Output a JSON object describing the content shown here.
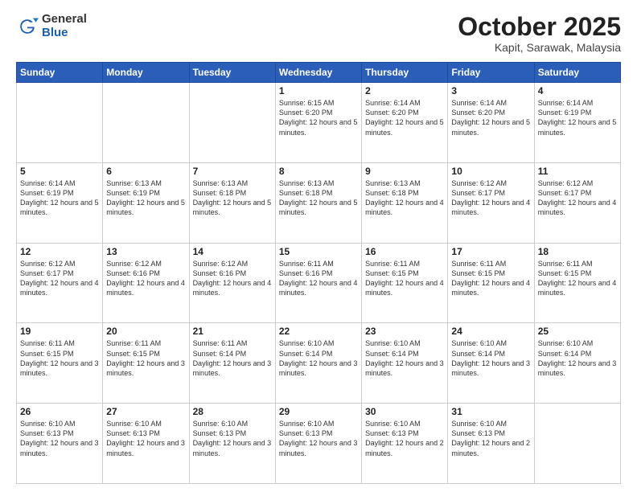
{
  "header": {
    "logo_general": "General",
    "logo_blue": "Blue",
    "month_title": "October 2025",
    "subtitle": "Kapit, Sarawak, Malaysia"
  },
  "days_of_week": [
    "Sunday",
    "Monday",
    "Tuesday",
    "Wednesday",
    "Thursday",
    "Friday",
    "Saturday"
  ],
  "weeks": [
    [
      {
        "day": "",
        "text": ""
      },
      {
        "day": "",
        "text": ""
      },
      {
        "day": "",
        "text": ""
      },
      {
        "day": "1",
        "text": "Sunrise: 6:15 AM\nSunset: 6:20 PM\nDaylight: 12 hours and 5 minutes."
      },
      {
        "day": "2",
        "text": "Sunrise: 6:14 AM\nSunset: 6:20 PM\nDaylight: 12 hours and 5 minutes."
      },
      {
        "day": "3",
        "text": "Sunrise: 6:14 AM\nSunset: 6:20 PM\nDaylight: 12 hours and 5 minutes."
      },
      {
        "day": "4",
        "text": "Sunrise: 6:14 AM\nSunset: 6:19 PM\nDaylight: 12 hours and 5 minutes."
      }
    ],
    [
      {
        "day": "5",
        "text": "Sunrise: 6:14 AM\nSunset: 6:19 PM\nDaylight: 12 hours and 5 minutes."
      },
      {
        "day": "6",
        "text": "Sunrise: 6:13 AM\nSunset: 6:19 PM\nDaylight: 12 hours and 5 minutes."
      },
      {
        "day": "7",
        "text": "Sunrise: 6:13 AM\nSunset: 6:18 PM\nDaylight: 12 hours and 5 minutes."
      },
      {
        "day": "8",
        "text": "Sunrise: 6:13 AM\nSunset: 6:18 PM\nDaylight: 12 hours and 5 minutes."
      },
      {
        "day": "9",
        "text": "Sunrise: 6:13 AM\nSunset: 6:18 PM\nDaylight: 12 hours and 4 minutes."
      },
      {
        "day": "10",
        "text": "Sunrise: 6:12 AM\nSunset: 6:17 PM\nDaylight: 12 hours and 4 minutes."
      },
      {
        "day": "11",
        "text": "Sunrise: 6:12 AM\nSunset: 6:17 PM\nDaylight: 12 hours and 4 minutes."
      }
    ],
    [
      {
        "day": "12",
        "text": "Sunrise: 6:12 AM\nSunset: 6:17 PM\nDaylight: 12 hours and 4 minutes."
      },
      {
        "day": "13",
        "text": "Sunrise: 6:12 AM\nSunset: 6:16 PM\nDaylight: 12 hours and 4 minutes."
      },
      {
        "day": "14",
        "text": "Sunrise: 6:12 AM\nSunset: 6:16 PM\nDaylight: 12 hours and 4 minutes."
      },
      {
        "day": "15",
        "text": "Sunrise: 6:11 AM\nSunset: 6:16 PM\nDaylight: 12 hours and 4 minutes."
      },
      {
        "day": "16",
        "text": "Sunrise: 6:11 AM\nSunset: 6:15 PM\nDaylight: 12 hours and 4 minutes."
      },
      {
        "day": "17",
        "text": "Sunrise: 6:11 AM\nSunset: 6:15 PM\nDaylight: 12 hours and 4 minutes."
      },
      {
        "day": "18",
        "text": "Sunrise: 6:11 AM\nSunset: 6:15 PM\nDaylight: 12 hours and 4 minutes."
      }
    ],
    [
      {
        "day": "19",
        "text": "Sunrise: 6:11 AM\nSunset: 6:15 PM\nDaylight: 12 hours and 3 minutes."
      },
      {
        "day": "20",
        "text": "Sunrise: 6:11 AM\nSunset: 6:15 PM\nDaylight: 12 hours and 3 minutes."
      },
      {
        "day": "21",
        "text": "Sunrise: 6:11 AM\nSunset: 6:14 PM\nDaylight: 12 hours and 3 minutes."
      },
      {
        "day": "22",
        "text": "Sunrise: 6:10 AM\nSunset: 6:14 PM\nDaylight: 12 hours and 3 minutes."
      },
      {
        "day": "23",
        "text": "Sunrise: 6:10 AM\nSunset: 6:14 PM\nDaylight: 12 hours and 3 minutes."
      },
      {
        "day": "24",
        "text": "Sunrise: 6:10 AM\nSunset: 6:14 PM\nDaylight: 12 hours and 3 minutes."
      },
      {
        "day": "25",
        "text": "Sunrise: 6:10 AM\nSunset: 6:14 PM\nDaylight: 12 hours and 3 minutes."
      }
    ],
    [
      {
        "day": "26",
        "text": "Sunrise: 6:10 AM\nSunset: 6:13 PM\nDaylight: 12 hours and 3 minutes."
      },
      {
        "day": "27",
        "text": "Sunrise: 6:10 AM\nSunset: 6:13 PM\nDaylight: 12 hours and 3 minutes."
      },
      {
        "day": "28",
        "text": "Sunrise: 6:10 AM\nSunset: 6:13 PM\nDaylight: 12 hours and 3 minutes."
      },
      {
        "day": "29",
        "text": "Sunrise: 6:10 AM\nSunset: 6:13 PM\nDaylight: 12 hours and 3 minutes."
      },
      {
        "day": "30",
        "text": "Sunrise: 6:10 AM\nSunset: 6:13 PM\nDaylight: 12 hours and 2 minutes."
      },
      {
        "day": "31",
        "text": "Sunrise: 6:10 AM\nSunset: 6:13 PM\nDaylight: 12 hours and 2 minutes."
      },
      {
        "day": "",
        "text": ""
      }
    ]
  ]
}
